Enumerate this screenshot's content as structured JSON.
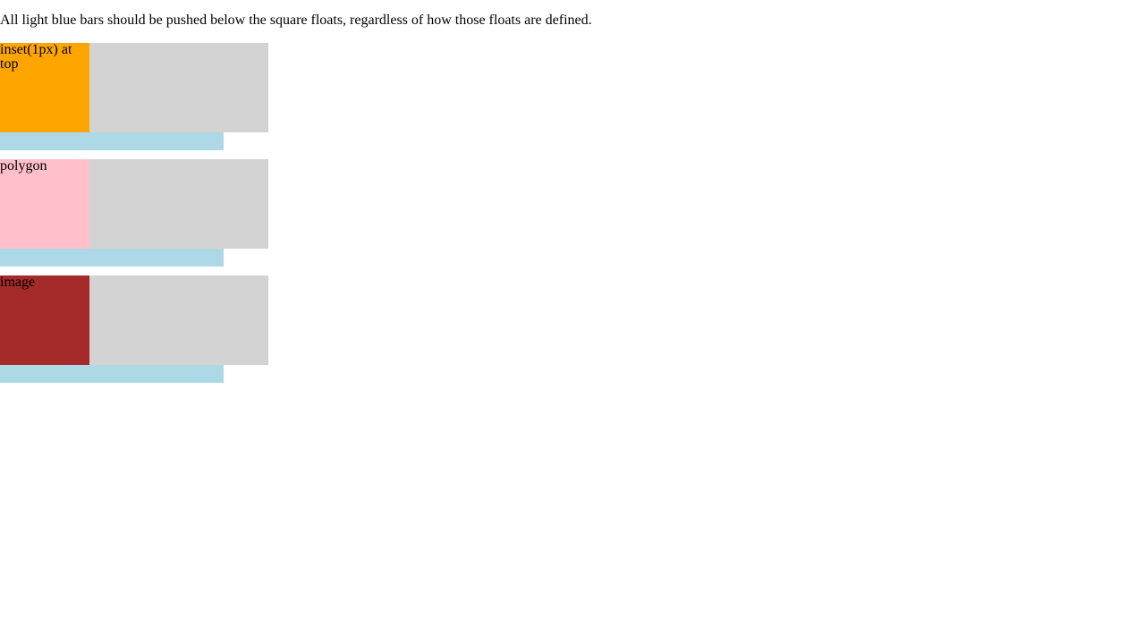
{
  "intro_text": "All light blue bars should be pushed below the square floats, regardless of how those floats are defined.",
  "colors": {
    "container": "#d3d3d3",
    "bar": "#add8e6"
  },
  "tests": [
    {
      "label": "inset(1px) at top",
      "color": "#ffa500"
    },
    {
      "label": "polygon",
      "color": "#ffc0cb"
    },
    {
      "label": "image",
      "color": "#a52a2a"
    }
  ]
}
